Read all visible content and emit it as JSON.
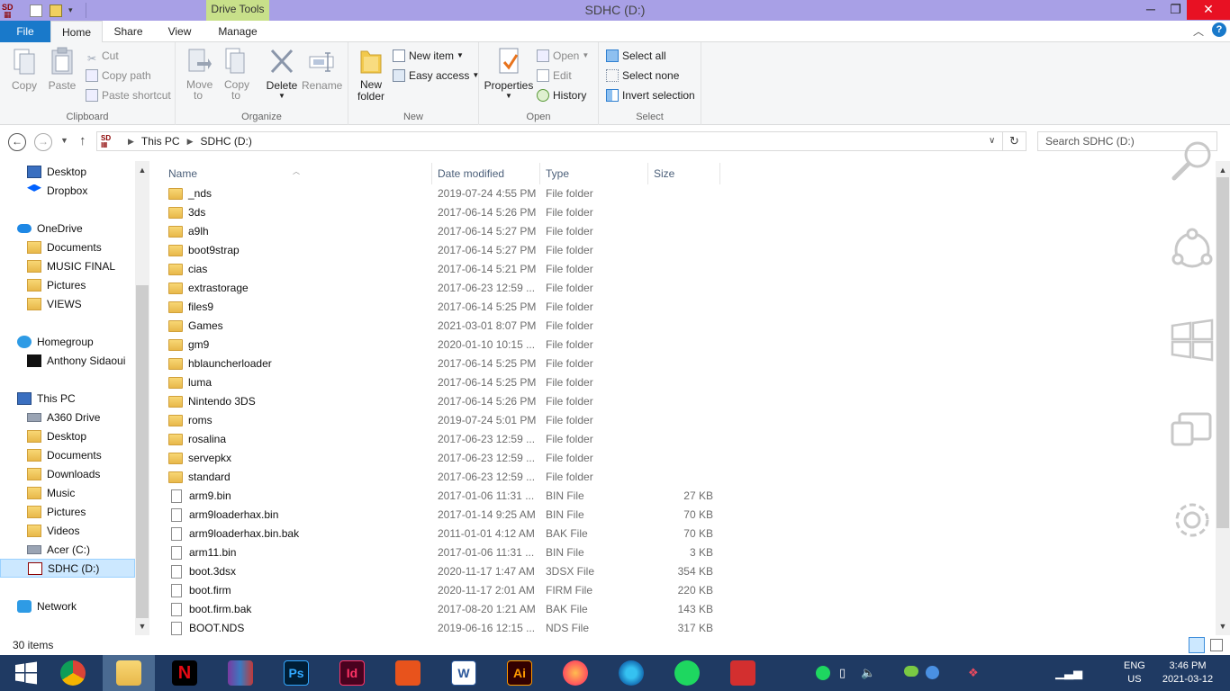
{
  "window": {
    "title": "SDHC (D:)",
    "drive_tools": "Drive Tools",
    "minimize": "─",
    "maximize": "❐",
    "close": "✕"
  },
  "ribbon_tabs": {
    "file": "File",
    "home": "Home",
    "share": "Share",
    "view": "View",
    "manage": "Manage"
  },
  "ribbon": {
    "clipboard": {
      "label": "Clipboard",
      "copy": "Copy",
      "paste": "Paste",
      "cut": "Cut",
      "copy_path": "Copy path",
      "paste_shortcut": "Paste shortcut"
    },
    "organize": {
      "label": "Organize",
      "move_to": "Move to",
      "copy_to": "Copy to",
      "delete": "Delete",
      "rename": "Rename"
    },
    "new": {
      "label": "New",
      "new_folder": "New folder",
      "new_item": "New item",
      "easy_access": "Easy access"
    },
    "open": {
      "label": "Open",
      "properties": "Properties",
      "open": "Open",
      "edit": "Edit",
      "history": "History"
    },
    "select": {
      "label": "Select",
      "select_all": "Select all",
      "select_none": "Select none",
      "invert_selection": "Invert selection"
    }
  },
  "address": {
    "path": [
      "This PC",
      "SDHC (D:)"
    ],
    "search_placeholder": "Search SDHC (D:)"
  },
  "navpane": {
    "items": [
      {
        "label": "Desktop",
        "indent": 1,
        "icon": "desktop"
      },
      {
        "label": "Dropbox",
        "indent": 1,
        "icon": "dropbox"
      },
      {
        "label": "OneDrive",
        "indent": 0,
        "icon": "cloud"
      },
      {
        "label": "Documents",
        "indent": 1,
        "icon": "folder"
      },
      {
        "label": "MUSIC FINAL",
        "indent": 1,
        "icon": "folder"
      },
      {
        "label": "Pictures",
        "indent": 1,
        "icon": "folder"
      },
      {
        "label": "VIEWS",
        "indent": 1,
        "icon": "folder"
      },
      {
        "label": "Homegroup",
        "indent": 0,
        "icon": "homegroup"
      },
      {
        "label": "Anthony Sidaoui",
        "indent": 1,
        "icon": "user"
      },
      {
        "label": "This PC",
        "indent": 0,
        "icon": "pc"
      },
      {
        "label": "A360 Drive",
        "indent": 1,
        "icon": "drive"
      },
      {
        "label": "Desktop",
        "indent": 1,
        "icon": "folder"
      },
      {
        "label": "Documents",
        "indent": 1,
        "icon": "folder"
      },
      {
        "label": "Downloads",
        "indent": 1,
        "icon": "folder"
      },
      {
        "label": "Music",
        "indent": 1,
        "icon": "folder"
      },
      {
        "label": "Pictures",
        "indent": 1,
        "icon": "folder"
      },
      {
        "label": "Videos",
        "indent": 1,
        "icon": "folder"
      },
      {
        "label": "Acer (C:)",
        "indent": 1,
        "icon": "drive"
      },
      {
        "label": "SDHC (D:)",
        "indent": 1,
        "icon": "sd",
        "selected": true
      },
      {
        "label": "Network",
        "indent": 0,
        "icon": "network"
      }
    ]
  },
  "columns": {
    "name": "Name",
    "date": "Date modified",
    "type": "Type",
    "size": "Size"
  },
  "files": [
    {
      "name": "_nds",
      "date": "2019-07-24 4:55 PM",
      "type": "File folder",
      "size": "",
      "folder": true
    },
    {
      "name": "3ds",
      "date": "2017-06-14 5:26 PM",
      "type": "File folder",
      "size": "",
      "folder": true
    },
    {
      "name": "a9lh",
      "date": "2017-06-14 5:27 PM",
      "type": "File folder",
      "size": "",
      "folder": true
    },
    {
      "name": "boot9strap",
      "date": "2017-06-14 5:27 PM",
      "type": "File folder",
      "size": "",
      "folder": true
    },
    {
      "name": "cias",
      "date": "2017-06-14 5:21 PM",
      "type": "File folder",
      "size": "",
      "folder": true
    },
    {
      "name": "extrastorage",
      "date": "2017-06-23 12:59 ...",
      "type": "File folder",
      "size": "",
      "folder": true
    },
    {
      "name": "files9",
      "date": "2017-06-14 5:25 PM",
      "type": "File folder",
      "size": "",
      "folder": true
    },
    {
      "name": "Games",
      "date": "2021-03-01 8:07 PM",
      "type": "File folder",
      "size": "",
      "folder": true
    },
    {
      "name": "gm9",
      "date": "2020-01-10 10:15 ...",
      "type": "File folder",
      "size": "",
      "folder": true
    },
    {
      "name": "hblauncherloader",
      "date": "2017-06-14 5:25 PM",
      "type": "File folder",
      "size": "",
      "folder": true
    },
    {
      "name": "luma",
      "date": "2017-06-14 5:25 PM",
      "type": "File folder",
      "size": "",
      "folder": true
    },
    {
      "name": "Nintendo 3DS",
      "date": "2017-06-14 5:26 PM",
      "type": "File folder",
      "size": "",
      "folder": true
    },
    {
      "name": "roms",
      "date": "2019-07-24 5:01 PM",
      "type": "File folder",
      "size": "",
      "folder": true
    },
    {
      "name": "rosalina",
      "date": "2017-06-23 12:59 ...",
      "type": "File folder",
      "size": "",
      "folder": true
    },
    {
      "name": "servepkx",
      "date": "2017-06-23 12:59 ...",
      "type": "File folder",
      "size": "",
      "folder": true
    },
    {
      "name": "standard",
      "date": "2017-06-23 12:59 ...",
      "type": "File folder",
      "size": "",
      "folder": true
    },
    {
      "name": "arm9.bin",
      "date": "2017-01-06 11:31 ...",
      "type": "BIN File",
      "size": "27 KB",
      "folder": false
    },
    {
      "name": "arm9loaderhax.bin",
      "date": "2017-01-14 9:25 AM",
      "type": "BIN File",
      "size": "70 KB",
      "folder": false
    },
    {
      "name": "arm9loaderhax.bin.bak",
      "date": "2011-01-01 4:12 AM",
      "type": "BAK File",
      "size": "70 KB",
      "folder": false
    },
    {
      "name": "arm11.bin",
      "date": "2017-01-06 11:31 ...",
      "type": "BIN File",
      "size": "3 KB",
      "folder": false
    },
    {
      "name": "boot.3dsx",
      "date": "2020-11-17 1:47 AM",
      "type": "3DSX File",
      "size": "354 KB",
      "folder": false
    },
    {
      "name": "boot.firm",
      "date": "2020-11-17 2:01 AM",
      "type": "FIRM File",
      "size": "220 KB",
      "folder": false
    },
    {
      "name": "boot.firm.bak",
      "date": "2017-08-20 1:21 AM",
      "type": "BAK File",
      "size": "143 KB",
      "folder": false
    },
    {
      "name": "BOOT.NDS",
      "date": "2019-06-16 12:15 ...",
      "type": "NDS File",
      "size": "317 KB",
      "folder": false
    }
  ],
  "status": {
    "count": "30 items"
  },
  "taskbar": {
    "apps": [
      {
        "name": "chrome",
        "label": ""
      },
      {
        "name": "file-explorer",
        "label": "",
        "active": true
      },
      {
        "name": "netflix",
        "label": "N"
      },
      {
        "name": "winrar",
        "label": ""
      },
      {
        "name": "photoshop",
        "label": "Ps"
      },
      {
        "name": "indesign",
        "label": "Id"
      },
      {
        "name": "office",
        "label": ""
      },
      {
        "name": "word",
        "label": "W"
      },
      {
        "name": "illustrator",
        "label": "Ai"
      },
      {
        "name": "firefox",
        "label": ""
      },
      {
        "name": "edge",
        "label": ""
      },
      {
        "name": "spotify",
        "label": ""
      },
      {
        "name": "acrobat",
        "label": ""
      }
    ],
    "lang_top": "ENG",
    "lang_bottom": "US",
    "time": "3:46 PM",
    "date": "2021-03-12"
  },
  "colors": {
    "titlebar": "#a8a0e6",
    "drive_tools": "#c8e08a",
    "file_tab": "#1979ca",
    "close": "#e81123",
    "taskbar": "#1f3a63"
  }
}
